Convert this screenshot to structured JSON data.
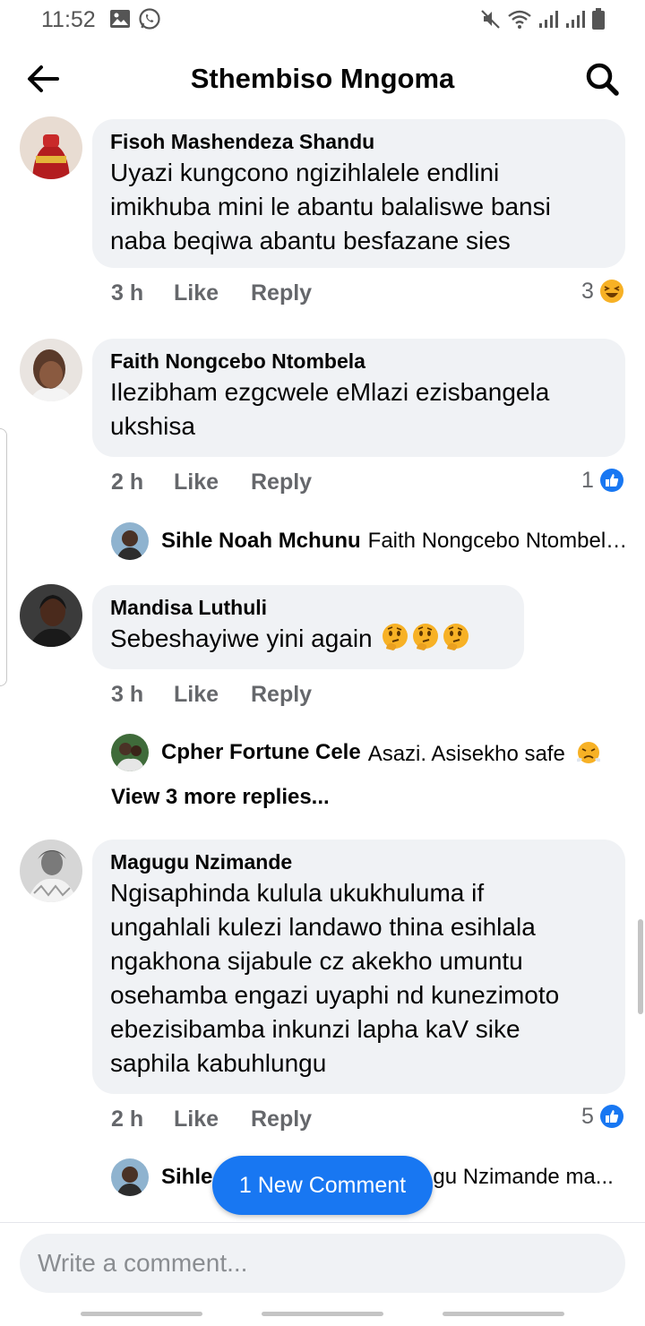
{
  "status_bar": {
    "time": "11:52",
    "left_icons": [
      "image-icon",
      "whatsapp-icon"
    ],
    "right_icons": [
      "mute-icon",
      "wifi-icon",
      "signal-icon",
      "signal-icon",
      "battery-icon"
    ]
  },
  "header": {
    "title": "Sthembiso Mngoma",
    "back_icon": "arrow-left-icon",
    "search_icon": "search-icon"
  },
  "comments": [
    {
      "name": "Fisoh Mashendeza Shandu",
      "lines": [
        "Uyazi kungcono ngizihlalele endlini",
        "imikhuba mini le abantu balaliswe bansi",
        "naba beqiwa abantu besfazane sies"
      ],
      "time": "3 h",
      "like": "Like",
      "reply": "Reply",
      "reaction_count": "3",
      "reaction_icon": "haha-reaction-icon"
    },
    {
      "name": "Faith Nongcebo Ntombela",
      "lines": [
        "Ilezibham ezgcwele eMlazi ezisbangela",
        "ukshisa"
      ],
      "time": "2 h",
      "like": "Like",
      "reply": "Reply",
      "reaction_count": "1",
      "reaction_icon": "like-reaction-icon",
      "reply_preview": {
        "name": "Sihle Noah Mchunu",
        "text": "Faith Nongcebo Ntombela ..."
      }
    },
    {
      "name": "Mandisa Luthuli",
      "lines": [
        "Sebeshayiwe yini again"
      ],
      "emojis": [
        "thinking-face-icon",
        "thinking-face-icon",
        "thinking-face-icon"
      ],
      "time": "3 h",
      "like": "Like",
      "reply": "Reply",
      "reply_preview": {
        "name": "Cpher Fortune Cele",
        "text": "Asazi. Asisekho safe",
        "emoji": "steam-nose-face-icon"
      },
      "view_more": "View 3 more replies..."
    },
    {
      "name": "Magugu Nzimande",
      "lines": [
        "Ngisaphinda kulula ukukhuluma if",
        "ungahlali kulezi landawo thina esihlala",
        "ngakhona sijabule cz akekho umuntu",
        "osehamba engazi uyaphi nd kunezimoto",
        "ebezisibamba inkunzi lapha kaV sike",
        "saphila kabuhlungu"
      ],
      "time": "2 h",
      "like": "Like",
      "reply": "Reply",
      "reaction_count": "5",
      "reaction_icon": "like-reaction-icon",
      "reply_preview": {
        "name": "Sihle",
        "text": "gu Nzimande ma..."
      }
    }
  ],
  "new_comment_pill": "1 New Comment",
  "composer": {
    "placeholder": "Write a comment..."
  },
  "colors": {
    "accent": "#1877f2",
    "bubble": "#f0f2f5",
    "secondary_text": "#65676b",
    "haha": "#f7b125"
  }
}
